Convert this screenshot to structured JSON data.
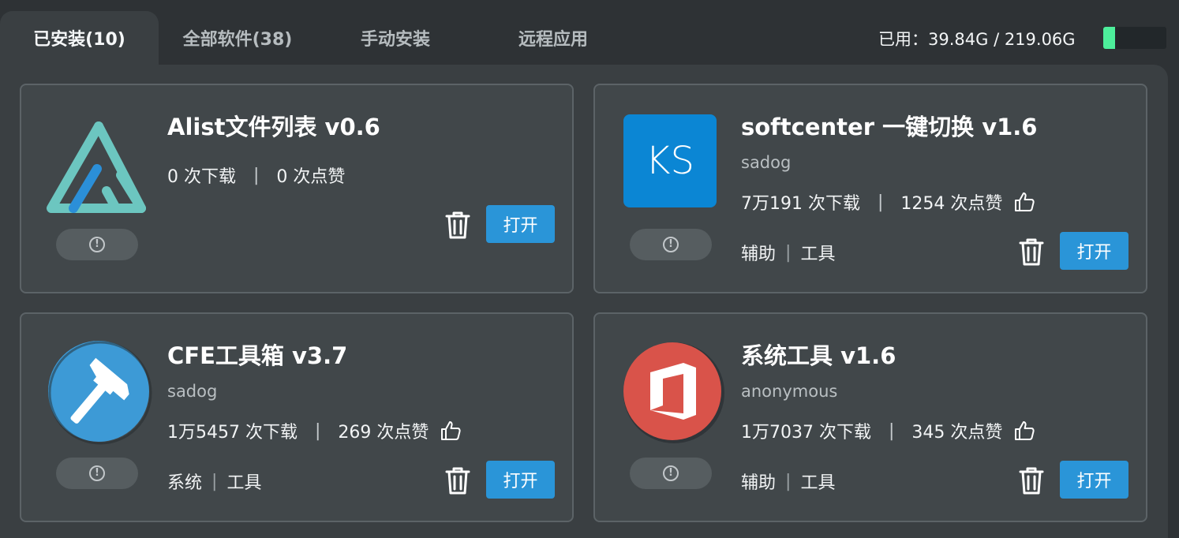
{
  "tabs": [
    {
      "label": "已安装(10)",
      "active": true
    },
    {
      "label": "全部软件(38)",
      "active": false
    },
    {
      "label": "手动安装",
      "active": false
    },
    {
      "label": "远程应用",
      "active": false
    }
  ],
  "storage": {
    "label": "已用：39.84G / 219.06G",
    "used_fraction": 0.182,
    "fill_color": "#4dee9b"
  },
  "cards": [
    {
      "icon": "alist-logo-icon",
      "title": "Alist文件列表 v0.6",
      "author": "",
      "downloads": "0 次下载",
      "likes": "0 次点赞",
      "tags": [],
      "open_label": "打开"
    },
    {
      "icon": "ks-logo-icon",
      "icon_text": "KS",
      "title": "softcenter 一键切换 v1.6",
      "author": "sadog",
      "downloads": "7万191 次下载",
      "likes": "1254 次点赞",
      "tags": [
        "辅助",
        "工具"
      ],
      "open_label": "打开"
    },
    {
      "icon": "hammer-icon",
      "title": "CFE工具箱 v3.7",
      "author": "sadog",
      "downloads": "1万5457 次下载",
      "likes": "269 次点赞",
      "tags": [
        "系统",
        "工具"
      ],
      "open_label": "打开"
    },
    {
      "icon": "office-logo-icon",
      "title": "系统工具 v1.6",
      "author": "anonymous",
      "downloads": "1万7037 次下载",
      "likes": "345 次点赞",
      "tags": [
        "辅助",
        "工具"
      ],
      "open_label": "打开"
    }
  ],
  "colors": {
    "accent": "#2a95d8",
    "card_bg": "#41474a",
    "page_bg": "#2e3235"
  }
}
